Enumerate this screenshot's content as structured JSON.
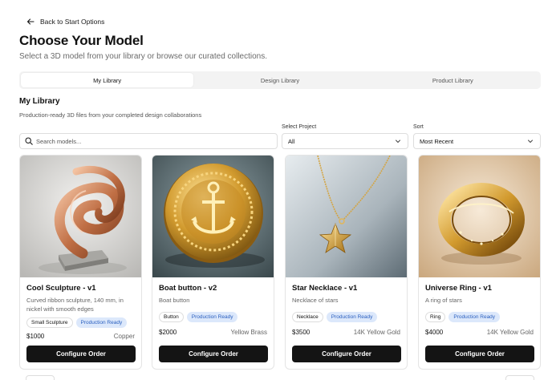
{
  "nav": {
    "back_label": "Back to Start Options"
  },
  "header": {
    "title": "Choose Your Model",
    "subtitle": "Select a 3D model from your library or browse our curated collections."
  },
  "tabs": [
    {
      "label": "My Library",
      "active": true
    },
    {
      "label": "Design Library",
      "active": false
    },
    {
      "label": "Product Library",
      "active": false
    }
  ],
  "library": {
    "title": "My Library",
    "description": "Production-ready 3D files from your completed design collaborations"
  },
  "filters": {
    "search_placeholder": "Search models...",
    "project_label": "Select Project",
    "project_value": "All",
    "sort_label": "Sort",
    "sort_value": "Most Recent"
  },
  "cards": [
    {
      "name": "Cool Sculpture - v1",
      "description": "Curved ribbon sculpture, 140 mm, in nickel with smooth edges",
      "tag": "Small Sculpture",
      "status": "Production Ready",
      "price": "$1000",
      "material": "Copper",
      "cta": "Configure Order",
      "image_icon": "copper-sculpture-image"
    },
    {
      "name": "Boat button - v2",
      "description": "Boat button",
      "tag": "Button",
      "status": "Production Ready",
      "price": "$2000",
      "material": "Yellow Brass",
      "cta": "Configure Order",
      "image_icon": "anchor-button-image"
    },
    {
      "name": "Star Necklace - v1",
      "description": "Necklace of stars",
      "tag": "Necklace",
      "status": "Production Ready",
      "price": "$3500",
      "material": "14K Yellow Gold",
      "cta": "Configure Order",
      "image_icon": "star-necklace-image"
    },
    {
      "name": "Universe Ring - v1",
      "description": "A ring of stars",
      "tag": "Ring",
      "status": "Production Ready",
      "price": "$4000",
      "material": "14K Yellow Gold",
      "cta": "Configure Order",
      "image_icon": "gold-ring-image"
    }
  ],
  "colors": {
    "primary_button": "#141414",
    "status_badge_bg": "#dce8fb",
    "status_badge_text": "#2a5fbf"
  }
}
